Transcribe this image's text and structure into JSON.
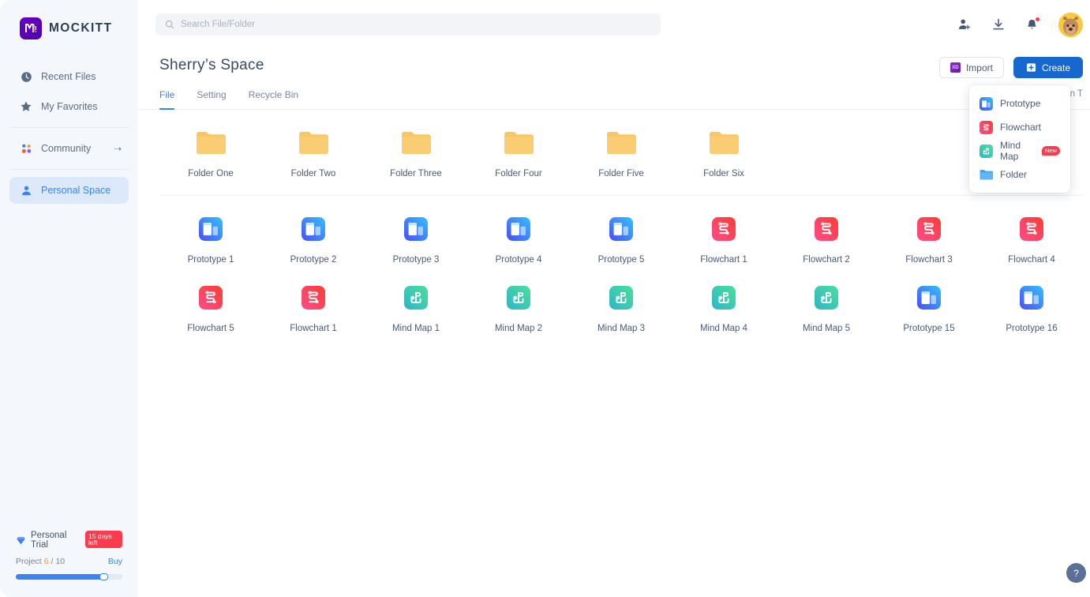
{
  "brand": {
    "name": "MOCKITT",
    "logo_icon": "mockitt-logo-icon"
  },
  "sidebar": {
    "items": [
      {
        "label": "Recent Files",
        "icon": "clock-icon",
        "active": false
      },
      {
        "label": "My Favorites",
        "icon": "star-icon",
        "active": false
      },
      {
        "label": "Community",
        "icon": "community-icon",
        "active": false,
        "arrow": "⇢"
      },
      {
        "label": "Personal Space",
        "icon": "person-icon",
        "active": true
      }
    ],
    "trial": {
      "icon": "diamond-icon",
      "label": "Personal Trial",
      "days_badge": "15 days left",
      "project_label": "Project",
      "project_used": "6",
      "project_divider": "/",
      "project_total": "10",
      "buy_label": "Buy",
      "progress_percent": 86
    }
  },
  "topbar": {
    "search": {
      "placeholder": "Search File/Folder",
      "value": "",
      "icon": "search-icon"
    },
    "icons": [
      {
        "name": "add-member-icon"
      },
      {
        "name": "download-icon"
      },
      {
        "name": "notification-bell-icon",
        "has_dot": true
      }
    ],
    "avatar": {
      "name": "user-avatar"
    }
  },
  "page": {
    "title": "Sherry’s Space",
    "import_button": "Import",
    "create_button": "Create",
    "sort_label": "Creation T",
    "tabs": [
      {
        "label": "File",
        "active": true
      },
      {
        "label": "Setting",
        "active": false
      },
      {
        "label": "Recycle Bin",
        "active": false
      }
    ]
  },
  "create_menu": {
    "items": [
      {
        "label": "Prototype",
        "icon": "prototype-icon",
        "badge": ""
      },
      {
        "label": "Flowchart",
        "icon": "flowchart-icon",
        "badge": ""
      },
      {
        "label": "Mind Map",
        "icon": "mindmap-icon",
        "badge": "New"
      },
      {
        "label": "Folder",
        "icon": "folder-blue-icon",
        "badge": ""
      }
    ]
  },
  "rows": [
    {
      "items": [
        {
          "name": "Folder One",
          "type": "folder"
        },
        {
          "name": "Folder Two",
          "type": "folder"
        },
        {
          "name": "Folder Three",
          "type": "folder"
        },
        {
          "name": "Folder Four",
          "type": "folder"
        },
        {
          "name": "Folder Five",
          "type": "folder"
        },
        {
          "name": "Folder Six",
          "type": "folder"
        }
      ]
    },
    {
      "items": [
        {
          "name": "Prototype 1",
          "type": "prototype"
        },
        {
          "name": "Prototype 2",
          "type": "prototype"
        },
        {
          "name": "Prototype 3",
          "type": "prototype"
        },
        {
          "name": "Prototype 4",
          "type": "prototype"
        },
        {
          "name": "Prototype 5",
          "type": "prototype"
        },
        {
          "name": "Flowchart 1",
          "type": "flowchart"
        },
        {
          "name": "Flowchart 2",
          "type": "flowchart"
        },
        {
          "name": "Flowchart 3",
          "type": "flowchart"
        },
        {
          "name": "Flowchart 4",
          "type": "flowchart"
        }
      ]
    },
    {
      "items": [
        {
          "name": "Flowchart 5",
          "type": "flowchart"
        },
        {
          "name": "Flowchart 1",
          "type": "flowchart"
        },
        {
          "name": "Mind Map 1",
          "type": "mindmap"
        },
        {
          "name": "Mind Map 2",
          "type": "mindmap"
        },
        {
          "name": "Mind Map 3",
          "type": "mindmap"
        },
        {
          "name": "Mind Map 4",
          "type": "mindmap"
        },
        {
          "name": "Mind Map 5",
          "type": "mindmap"
        },
        {
          "name": "Prototype 15",
          "type": "prototype"
        },
        {
          "name": "Prototype 16",
          "type": "prototype"
        }
      ]
    }
  ],
  "help_button": {
    "label": "?"
  },
  "colors": {
    "accent_blue": "#3c82f6",
    "create_blue": "#1668cf",
    "folder_yellow": "#f8c765",
    "flowchart_red": "#fb4455",
    "mindmap_teal": "#3fd1ab",
    "badge_red": "#fb3b4e",
    "sidebar_bg": "#f4f7fc"
  }
}
